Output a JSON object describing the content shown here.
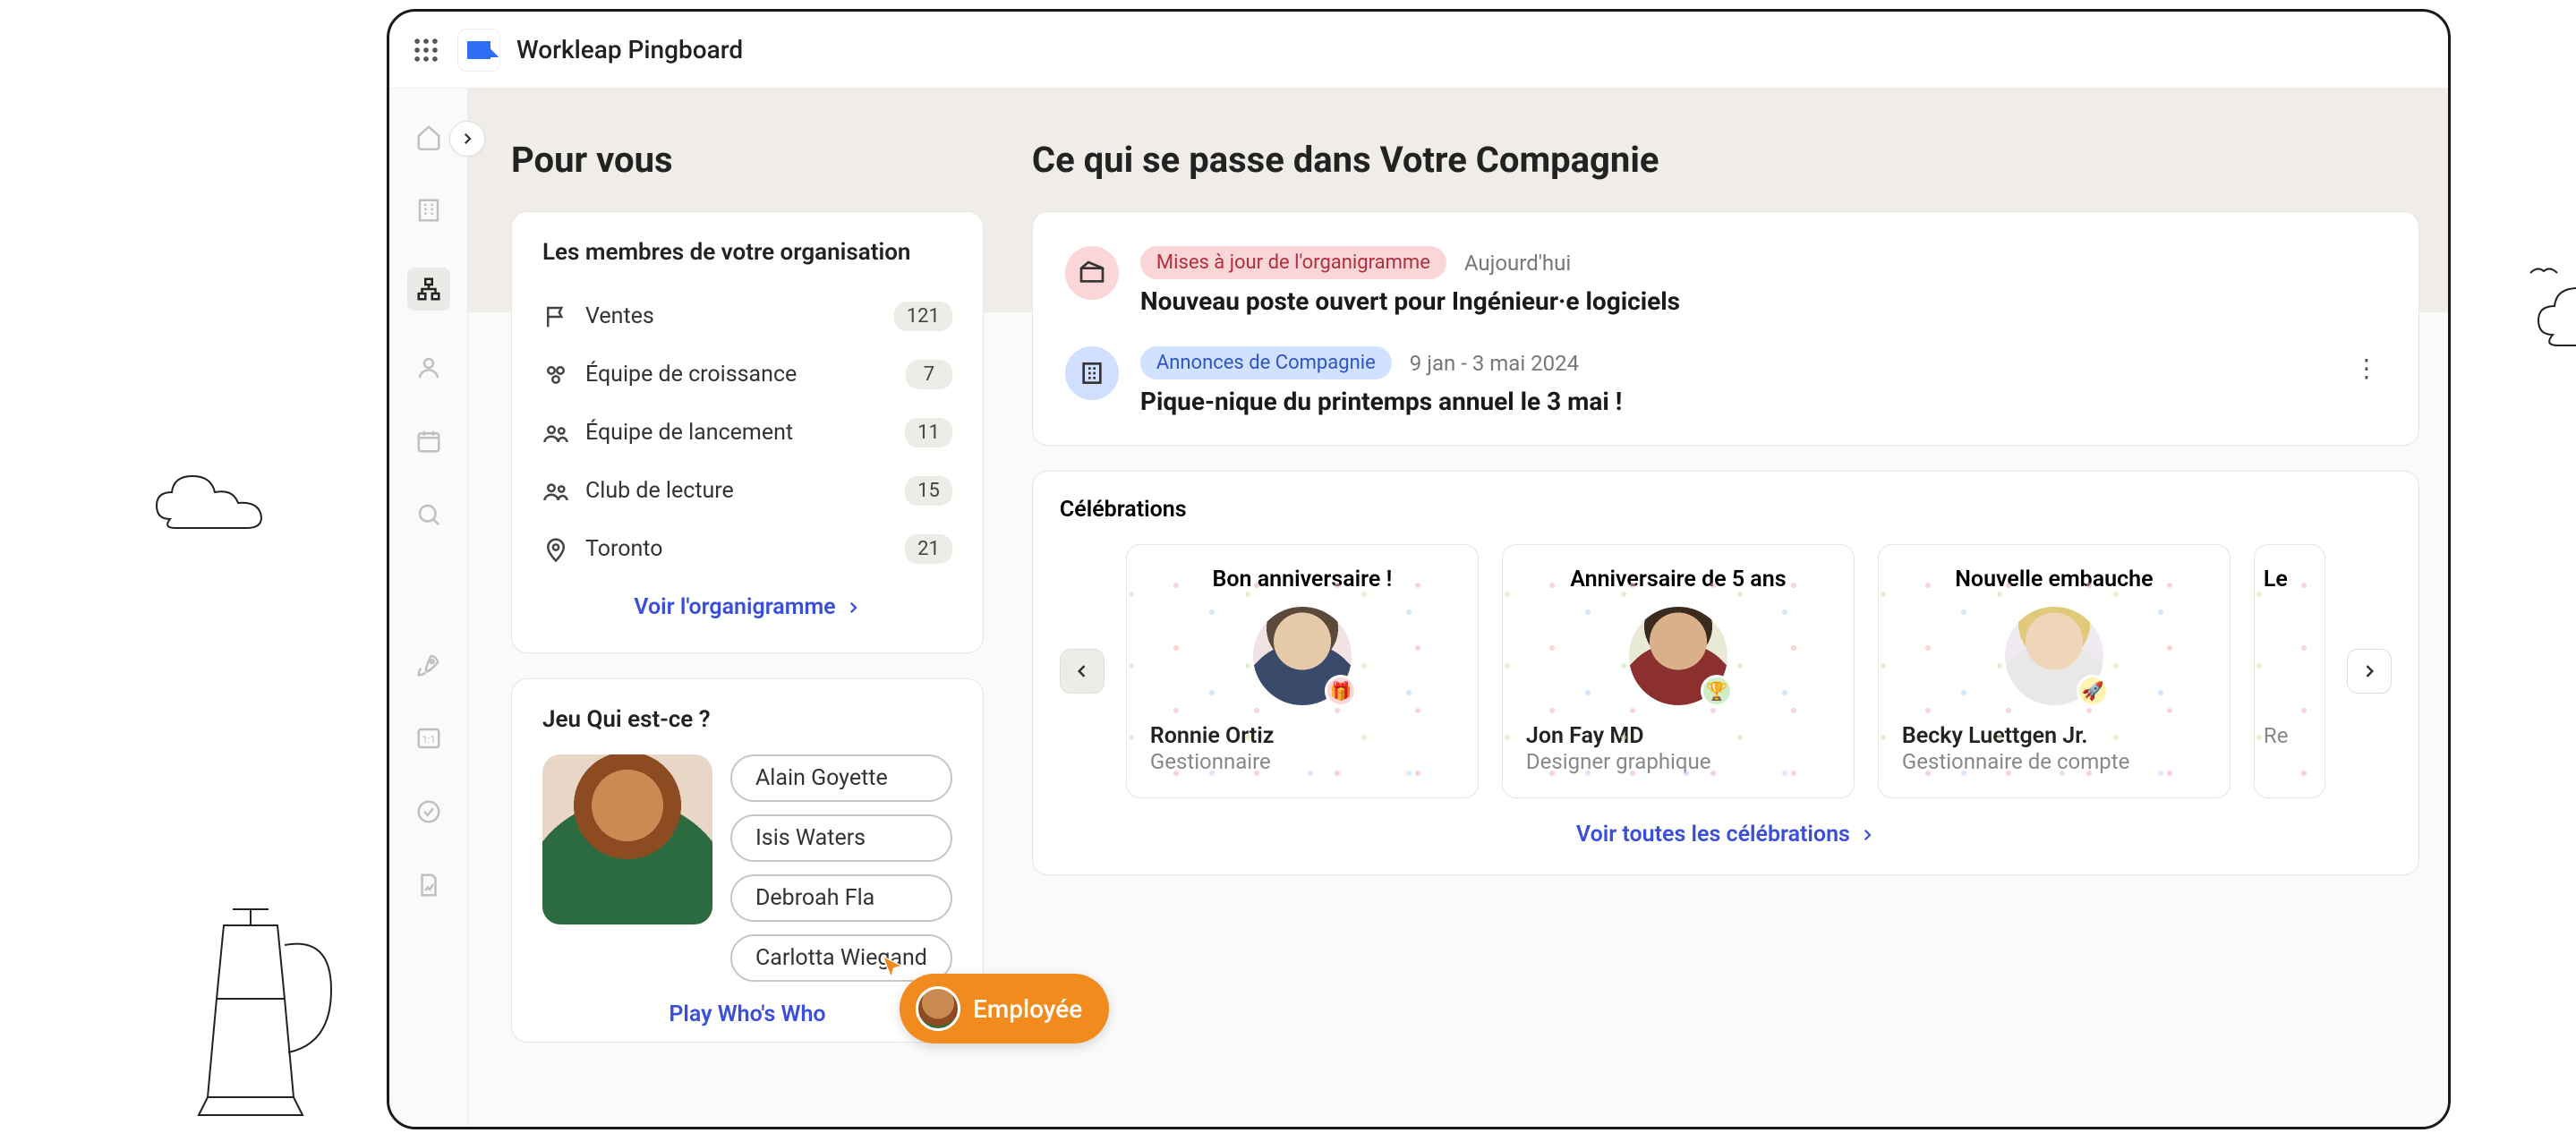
{
  "app": {
    "title": "Workleap Pingboard"
  },
  "left": {
    "heading": "Pour vous",
    "org": {
      "title": "Les membres de votre organisation",
      "rows": [
        {
          "label": "Ventes",
          "count": "121"
        },
        {
          "label": "Équipe de croissance",
          "count": "7"
        },
        {
          "label": "Équipe de lancement",
          "count": "11"
        },
        {
          "label": "Club de lecture",
          "count": "15"
        },
        {
          "label": "Toronto",
          "count": "21"
        }
      ],
      "link": "Voir l'organigramme"
    },
    "whoswho": {
      "title": "Jeu Qui est-ce ?",
      "chips": [
        "Alain Goyette",
        "Isis Waters",
        "Debroah Fla",
        "Carlotta Wiegand"
      ],
      "cursor_label": "Employée",
      "play_link": "Play Who's Who"
    }
  },
  "right": {
    "heading": "Ce qui se passe dans Votre Compagnie",
    "feed": [
      {
        "tag": "Mises à jour de l'organigramme",
        "tag_style": "pink",
        "date": "Aujourd'hui",
        "title": "Nouveau poste ouvert pour Ingénieur·e logiciels"
      },
      {
        "tag": "Annonces de Compagnie",
        "tag_style": "blue",
        "date": "9 jan - 3 mai 2024",
        "title": "Pique-nique du printemps annuel le 3 mai !"
      }
    ],
    "celebrations": {
      "title": "Célébrations",
      "link": "Voir toutes les célébrations",
      "cards": [
        {
          "heading": "Bon anniversaire !",
          "name": "Ronnie Ortiz",
          "role": "Gestionnaire",
          "badge": "gift"
        },
        {
          "heading": "Anniversaire de 5 ans",
          "name": "Jon Fay MD",
          "role": "Designer graphique",
          "badge": "trophy"
        },
        {
          "heading": "Nouvelle embauche",
          "name": "Becky Luettgen Jr.",
          "role": "Gestionnaire de compte",
          "badge": "rocket"
        },
        {
          "heading": "Le",
          "name": "",
          "role": "Re",
          "badge": ""
        }
      ]
    }
  }
}
